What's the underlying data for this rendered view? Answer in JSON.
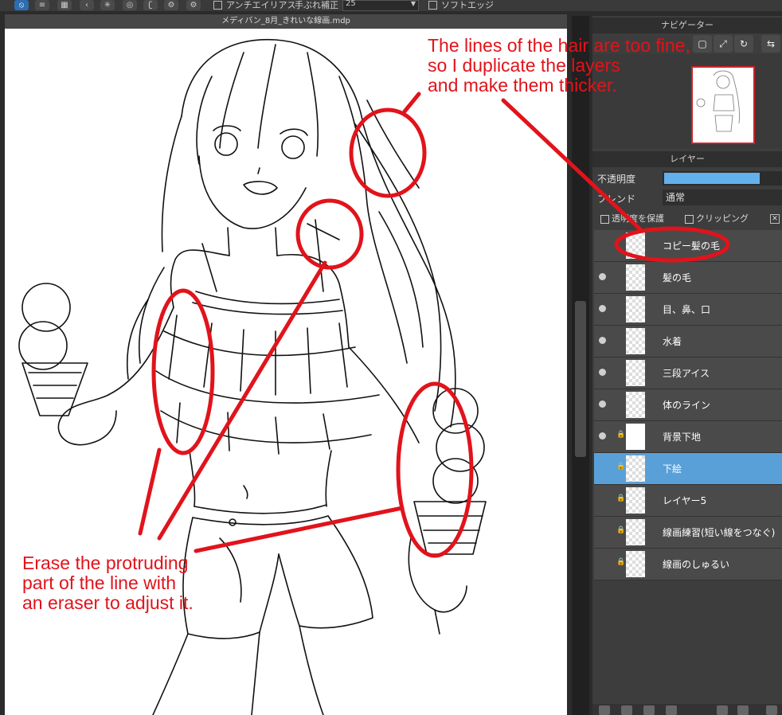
{
  "toolbar": {
    "antialias_label": "アンチエイリアス",
    "stabilizer_label": "手ぶれ補正",
    "stabilizer_value": "25",
    "soft_edge_label": "ソフトエッジ"
  },
  "document": {
    "title": "メディバン_8月_きれいな線画.mdp"
  },
  "navigator": {
    "title": "ナビゲーター"
  },
  "layers_panel": {
    "title": "レイヤー",
    "opacity_label": "不透明度",
    "opacity_value": 0.82,
    "blend_label": "ブレンド",
    "blend_value": "通常",
    "protect_alpha_label": "透明度を保護",
    "clipping_label": "クリッピング",
    "layers": [
      {
        "name": "コピー髪の毛",
        "visible": false,
        "locked": false,
        "selected": false
      },
      {
        "name": "髪の毛",
        "visible": true,
        "locked": false,
        "selected": false
      },
      {
        "name": "目、鼻、口",
        "visible": true,
        "locked": false,
        "selected": false
      },
      {
        "name": "水着",
        "visible": true,
        "locked": false,
        "selected": false
      },
      {
        "name": "三段アイス",
        "visible": true,
        "locked": false,
        "selected": false
      },
      {
        "name": "体のライン",
        "visible": true,
        "locked": false,
        "selected": false
      },
      {
        "name": "背景下地",
        "visible": true,
        "locked": true,
        "selected": false
      },
      {
        "name": "下絵",
        "visible": false,
        "locked": true,
        "selected": true
      },
      {
        "name": "レイヤー5",
        "visible": false,
        "locked": true,
        "selected": false
      },
      {
        "name": "線画練習(短い線をつなぐ)",
        "visible": false,
        "locked": true,
        "selected": false
      },
      {
        "name": "線画のしゅるい",
        "visible": false,
        "locked": true,
        "selected": false
      }
    ]
  },
  "annotations": {
    "top_line1": "The lines of the hair are too fine,",
    "top_line2": "so I duplicate the layers",
    "top_line3": "and make them thicker.",
    "bottom_line1": "Erase the protruding",
    "bottom_line2": "part of the line with",
    "bottom_line3": "an eraser to adjust it."
  },
  "colors": {
    "annotation_red": "#e1131b",
    "selected_layer": "#5aa0d8",
    "opacity_fill": "#62b0ec"
  }
}
